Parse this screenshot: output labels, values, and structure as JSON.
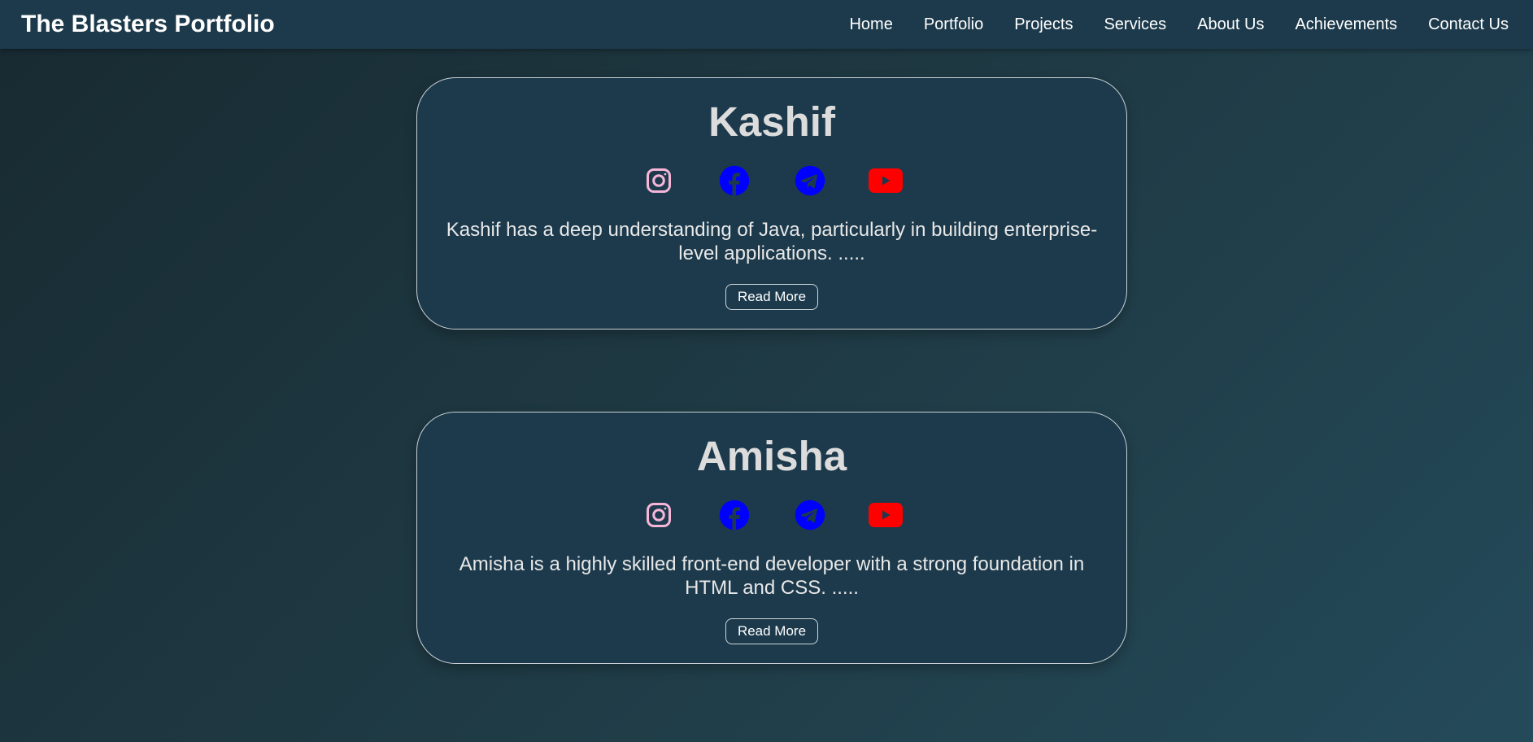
{
  "navbar": {
    "brand": "The Blasters Portfolio",
    "links": [
      "Home",
      "Portfolio",
      "Projects",
      "Services",
      "About Us",
      "Achievements",
      "Contact Us"
    ]
  },
  "cards": [
    {
      "name": "Kashif",
      "description": "Kashif has a deep understanding of Java, particularly in building enterprise-level applications. .....",
      "button": "Read More",
      "socials": [
        "instagram-icon",
        "facebook-icon",
        "telegram-icon",
        "youtube-icon"
      ]
    },
    {
      "name": "Amisha",
      "description": "Amisha is a highly skilled front-end developer with a strong foundation in HTML and CSS. .....",
      "button": "Read More",
      "socials": [
        "instagram-icon",
        "facebook-icon",
        "telegram-icon",
        "youtube-icon"
      ]
    }
  ],
  "colors": {
    "instagram": "#f7b6d8",
    "facebook": "#0000ff",
    "telegram": "#0000ff",
    "youtube": "#ff0000",
    "navbar": "#1c3a4b",
    "card": "#1c3a4c"
  }
}
